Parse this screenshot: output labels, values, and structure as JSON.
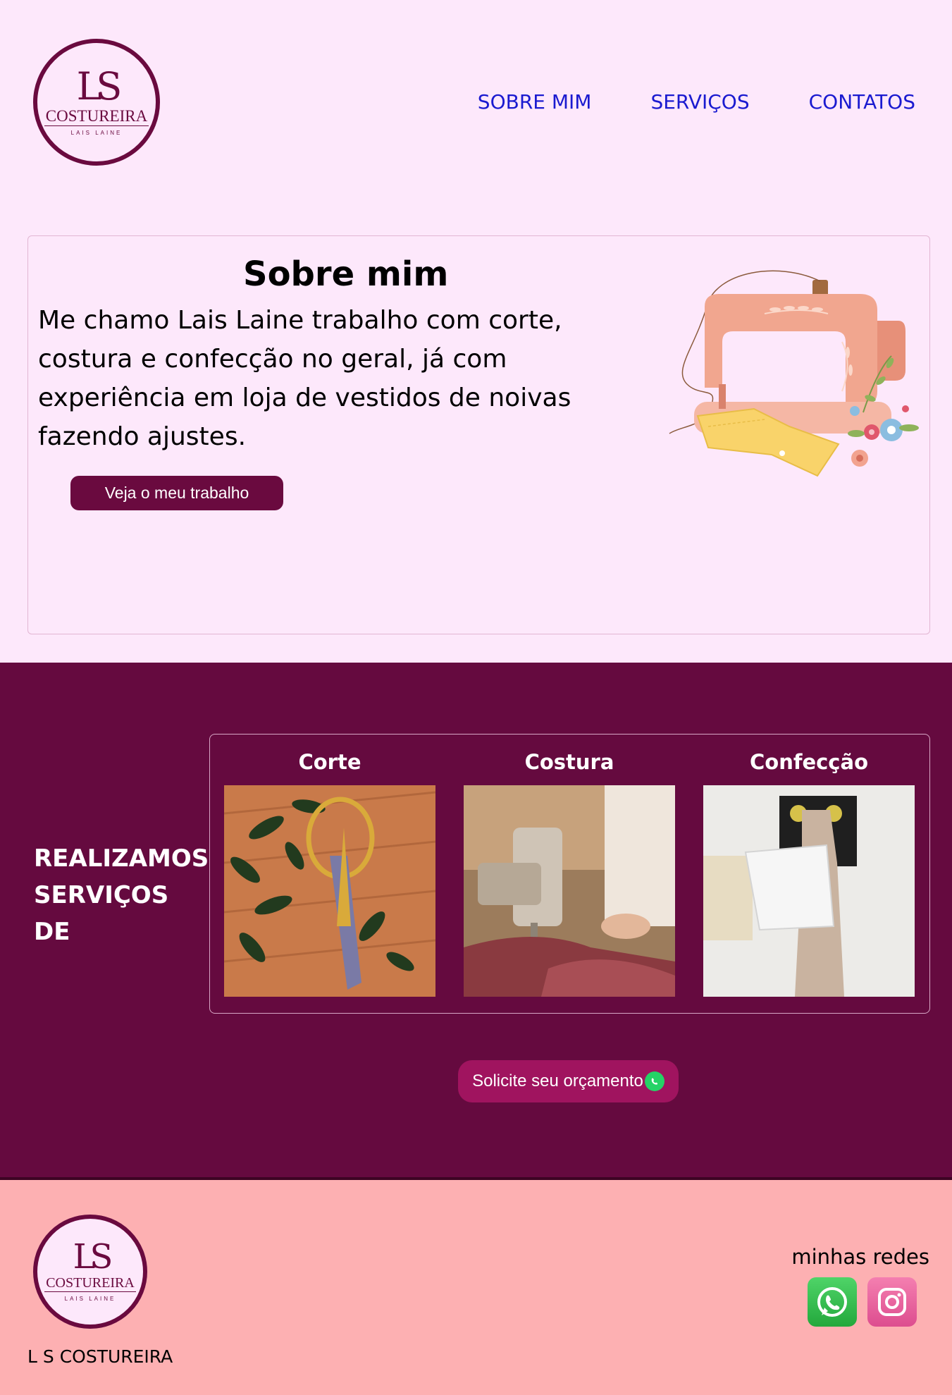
{
  "header": {
    "logo": {
      "letters": "LS",
      "brand": "COSTUREIRA",
      "sub": "LAIS LAINE"
    },
    "nav": [
      "SOBRE MIM",
      "SERVIÇOS",
      "CONTATOS"
    ]
  },
  "about": {
    "title": "Sobre mim",
    "text": "Me chamo Lais Laine trabalho com corte, costura e confecção no geral, já com experiência em loja de vestidos de noivas fazendo ajustes.",
    "button": "Veja o meu trabalho"
  },
  "services": {
    "heading": "REALIZAMOS SERVIÇOS DE",
    "items": [
      {
        "title": "Corte",
        "image": "scissors-photo"
      },
      {
        "title": "Costura",
        "image": "sewing-machine-photo"
      },
      {
        "title": "Confecção",
        "image": "dress-form-photo"
      }
    ],
    "quote_button": "Solicite seu orçamento"
  },
  "footer": {
    "logo": {
      "letters": "LS",
      "brand": "COSTUREIRA",
      "sub": "LAIS LAINE"
    },
    "name": "L S COSTUREIRA",
    "networks_label": "minhas redes",
    "icons": [
      "whatsapp-icon",
      "instagram-icon"
    ]
  },
  "colors": {
    "background": "#fde8fb",
    "primary": "#650a3f",
    "nav_link": "#1a1ad0",
    "quote_button": "#a0145f",
    "footer": "#fdb0b2"
  }
}
